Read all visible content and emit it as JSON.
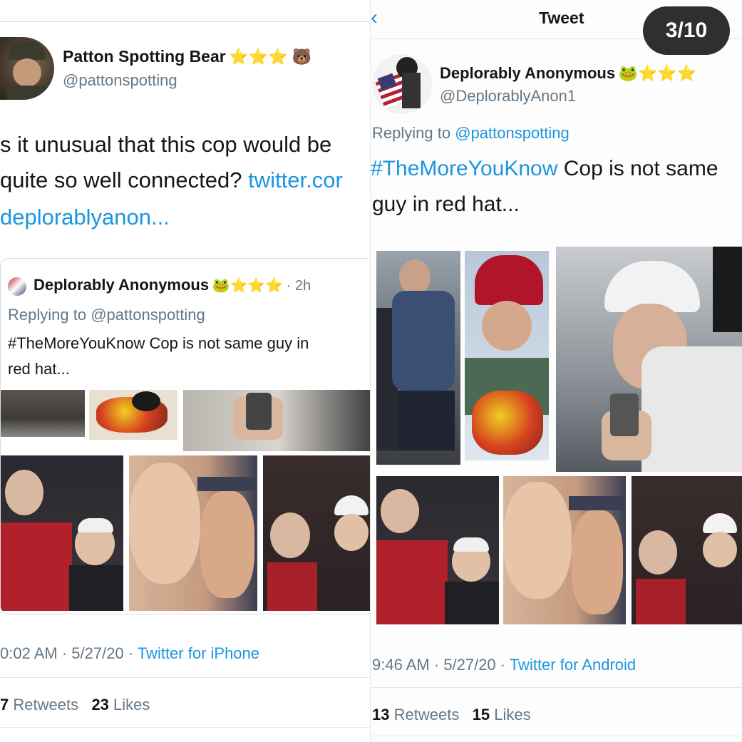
{
  "slide_counter": "3/10",
  "left": {
    "author": {
      "name": "Patton Spotting Bear",
      "emoji": "⭐⭐⭐ 🐻",
      "handle": "@pattonspotting"
    },
    "text_line1": "s it unusual that this cop would be",
    "text_line2": "quite so well connected?",
    "text_link1": "twitter.cor",
    "text_link2": "deplorablyanon...",
    "quote": {
      "name": "Deplorably Anonymous",
      "emoji": "🐸⭐⭐⭐",
      "time": "· 2h",
      "replying_prefix": "Replying to",
      "replying_handle": "@pattonspotting",
      "text_line1": "#TheMoreYouKnow Cop is not same guy in",
      "text_line2": "red hat..."
    },
    "meta_time": "0:02 AM · 5/27/20 ·",
    "meta_source": "Twitter for iPhone",
    "retweets": "7",
    "retweets_label": "Retweets",
    "likes": "23",
    "likes_label": "Likes"
  },
  "right": {
    "header_title": "Tweet",
    "back_icon": "chevron-left-icon",
    "author": {
      "name": "Deplorably Anonymous",
      "emoji": "🐸⭐⭐⭐",
      "handle": "@DeplorablyAnon1"
    },
    "replying_prefix": "Replying to",
    "replying_handle": "@pattonspotting",
    "hashtag": "#TheMoreYouKnow",
    "text_rest": "Cop is not same",
    "text_line2": "guy in red hat...",
    "meta_time": "9:46 AM · 5/27/20 ·",
    "meta_source": "Twitter for Android",
    "retweets": "13",
    "retweets_label": "Retweets",
    "likes": "15",
    "likes_label": "Likes"
  },
  "colors": {
    "link": "#1b95e0",
    "muted": "#657786",
    "text": "#14171a",
    "counter_bg": "#2f2f2f"
  }
}
